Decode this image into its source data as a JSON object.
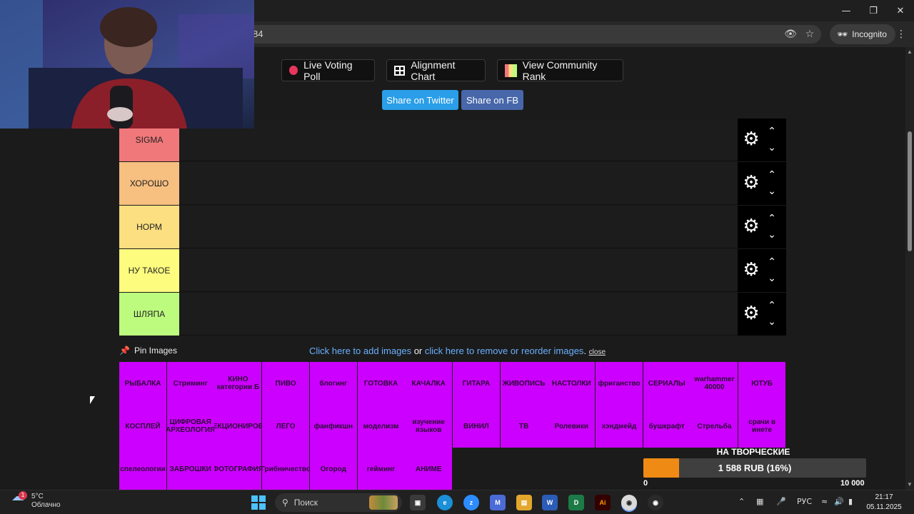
{
  "browser": {
    "url_fragment": "84",
    "incognito_label": "Incognito"
  },
  "toolbar": {
    "live_poll": "Live Voting Poll",
    "alignment_chart": "Alignment Chart",
    "community_rank": "View Community Rank",
    "share_twitter": "Share on Twitter",
    "share_fb": "Share on FB"
  },
  "tiers": [
    {
      "label": "SIGMA",
      "color": "#f1787a"
    },
    {
      "label": "ХОРОШО",
      "color": "#f7bf80"
    },
    {
      "label": "НОРМ",
      "color": "#fbdf80"
    },
    {
      "label": "НУ ТАКОЕ",
      "color": "#fdfc7e"
    },
    {
      "label": "ШЛЯПА",
      "color": "#bdfb7f"
    }
  ],
  "pin": {
    "label": "Pin Images",
    "add_link": "Click here to add images",
    "or": "or",
    "remove_link": "click here to remove or reorder images",
    "period": ".",
    "close": "close"
  },
  "items": [
    "РЫБАЛКА",
    "Стриминг",
    "КИНО категории Б",
    "ПИВО",
    "блогинг",
    "ГОТОВКА",
    "КАЧАЛКА",
    "ГИТАРА",
    "ЖИВОПИСЬ",
    "НАСТОЛКИ",
    "фриганство",
    "СЕРИАЛЫ",
    "warhammer 40000",
    "ЮТУБ",
    "КОСПЛЕЙ",
    "ЦИФРОВАЯ АРХЕОЛОГИЯ",
    "КОЛЛЕКЦИОНИРОВАНИЕ",
    "ЛЕГО",
    "фанфикшн",
    "моделизм",
    "изучение языков",
    "ВИНИЛ",
    "ТВ",
    "Ролевики",
    "хэндмейд",
    "бушкрафт",
    "Стрельба",
    "срачи в инете",
    "спелеологии",
    "ЗАБРОШКИ",
    "ФОТОГРАФИЯ",
    "Грибничество",
    "Огород",
    "гейминг",
    "АНИМЕ"
  ],
  "donation": {
    "title": "НА ТВОРЧЕСКИЕ ПЛАНЫ",
    "amount_text": "1 588 RUB (16%)",
    "progress": 0.16,
    "min": "0",
    "max": "10 000"
  },
  "taskbar": {
    "weather_temp": "5°C",
    "weather_desc": "Облачно",
    "weather_badge": "1",
    "search_placeholder": "Поиск",
    "lang": "РУС",
    "time": "21:17",
    "date": "05.11.2025"
  }
}
